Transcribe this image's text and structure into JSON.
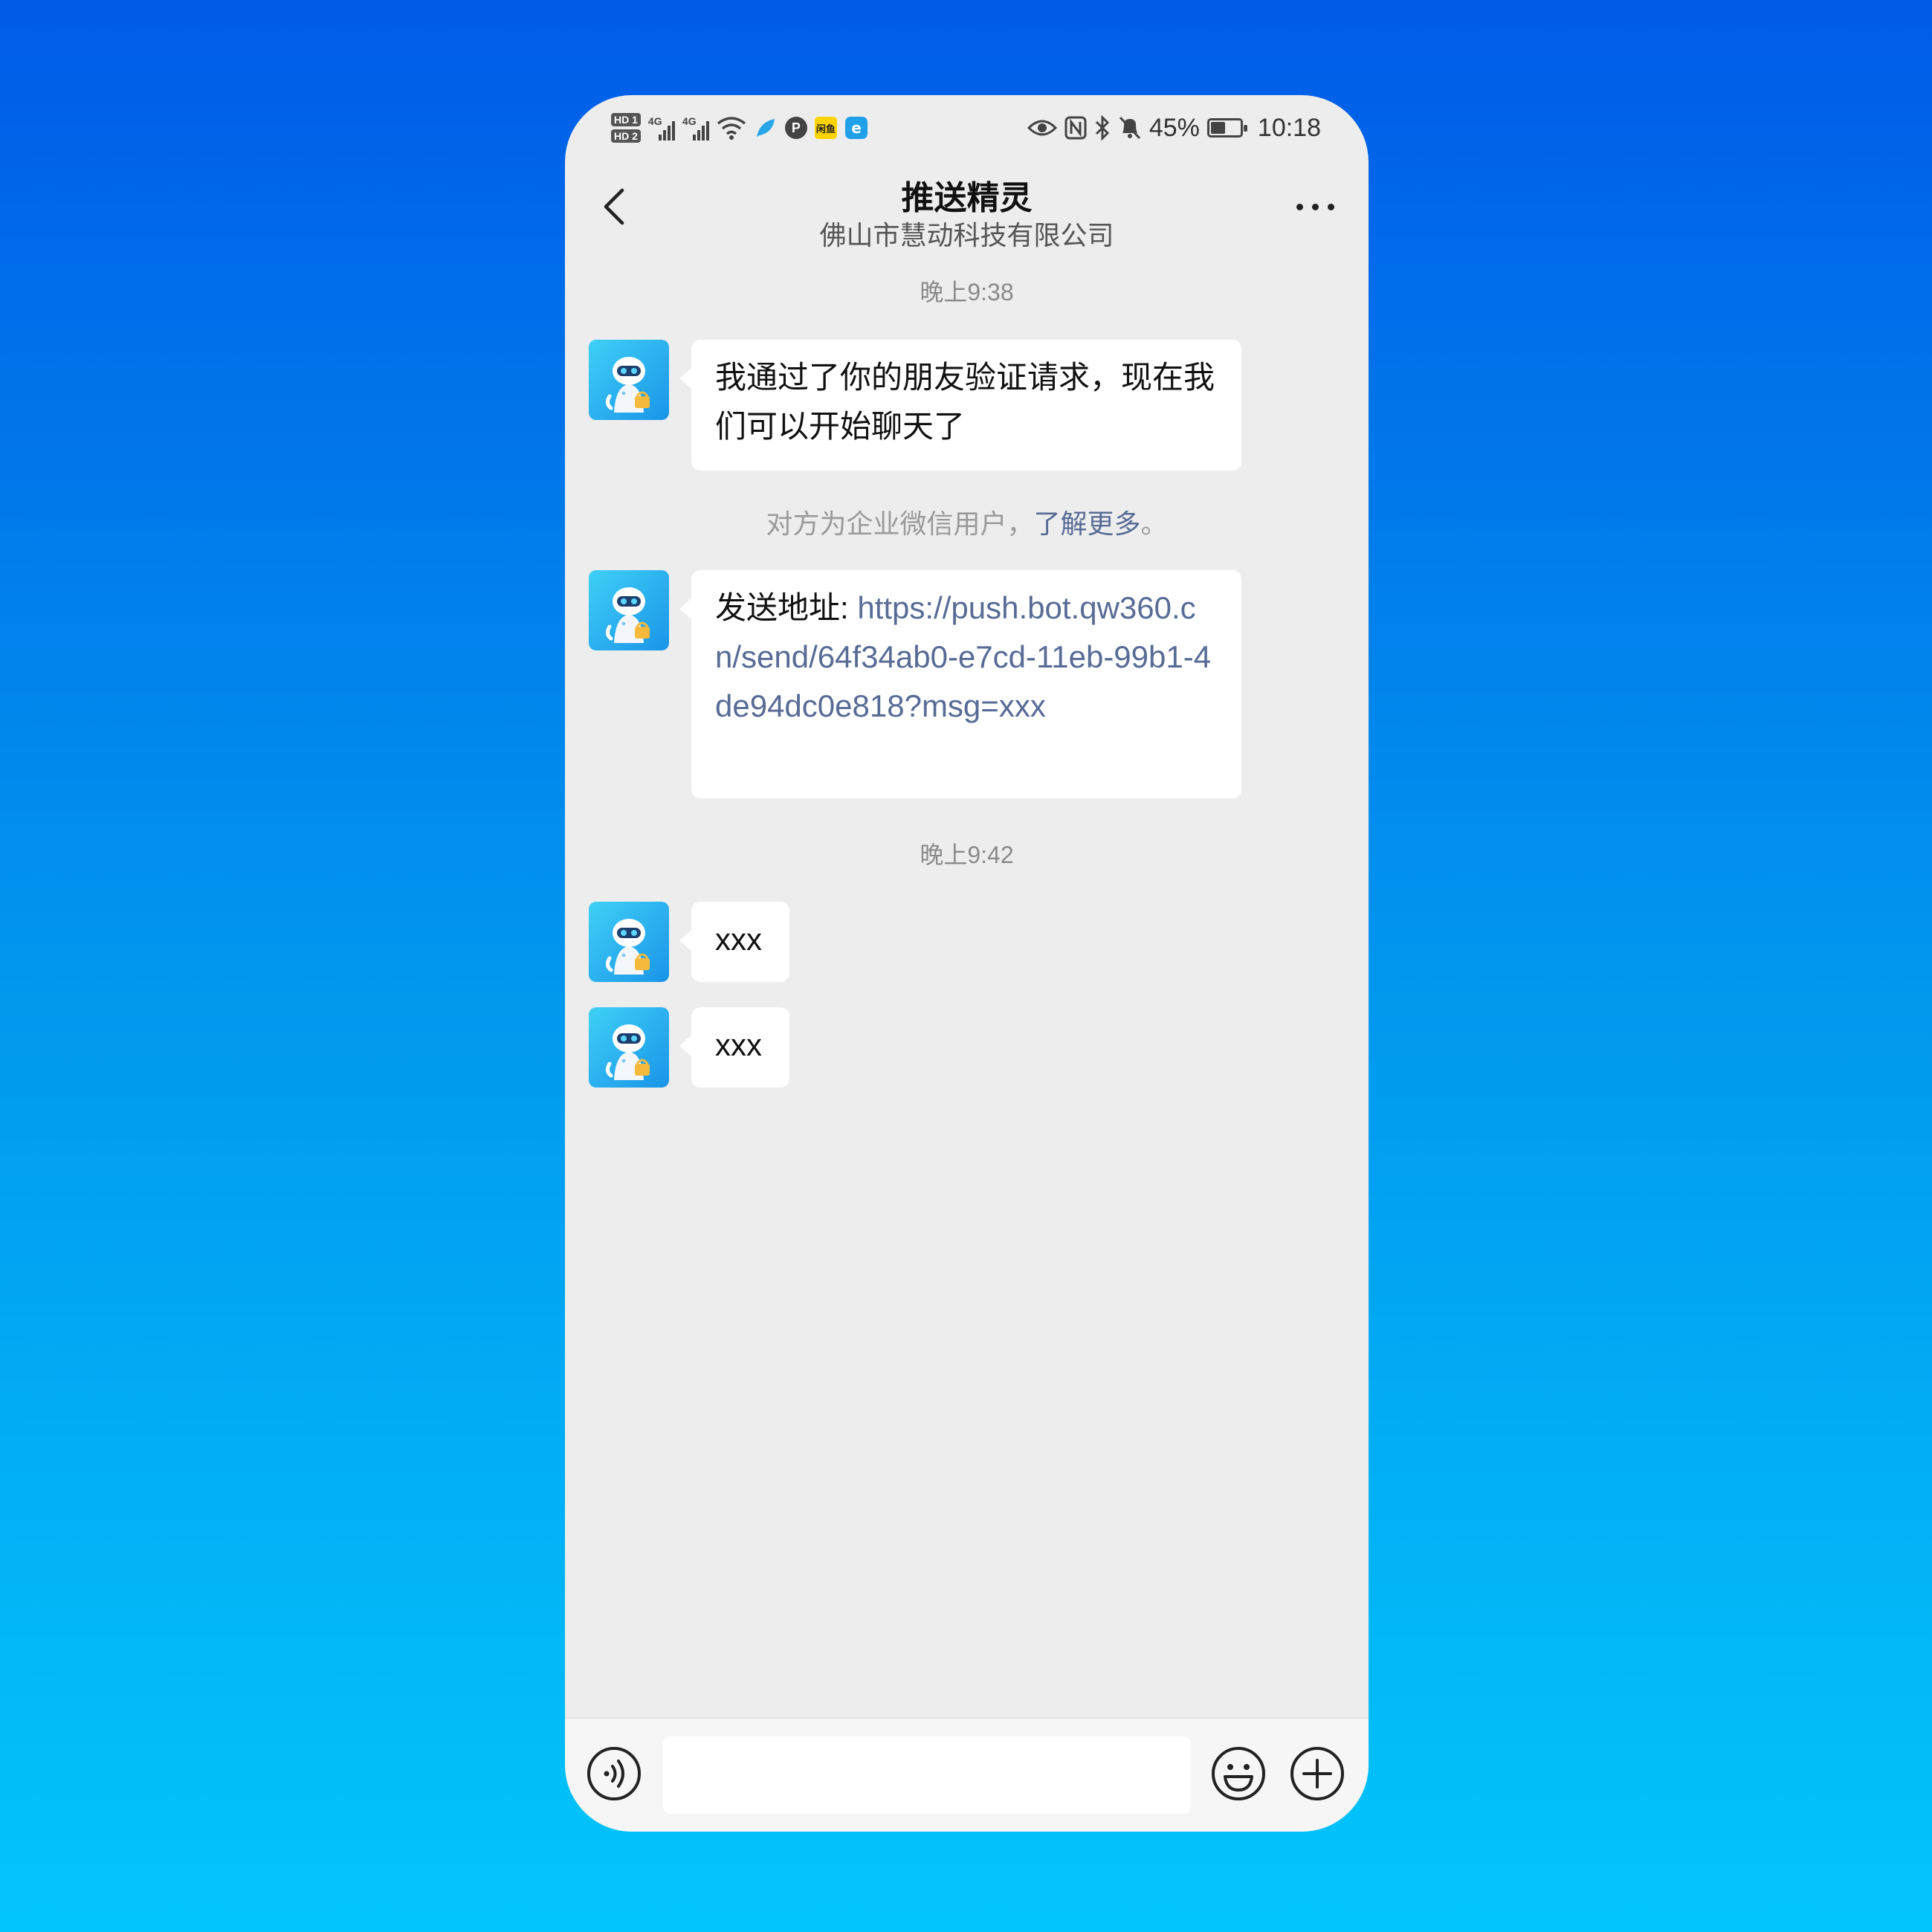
{
  "status_bar": {
    "battery_percent": "45%",
    "time": "10:18",
    "sim1_label": "HD 1",
    "sim2_label": "HD 2",
    "network1": "4G",
    "network2": "4G",
    "app_badge_p": "P",
    "app_badge_xianyu": "闲鱼",
    "icons": [
      "hd-icon",
      "signal-icon",
      "wifi-icon",
      "feather-app-icon",
      "p-app-icon",
      "xianyu-app-icon",
      "e-app-icon",
      "eye-icon",
      "nfc-icon",
      "bluetooth-icon",
      "mute-icon",
      "battery-icon"
    ]
  },
  "header": {
    "title": "推送精灵",
    "subtitle": "佛山市慧动科技有限公司",
    "back_icon": "chevron-left-icon",
    "more_icon": "more-dots-icon"
  },
  "chat": {
    "timestamp_1": "晚上9:38",
    "message_1": "我通过了你的朋友验证请求，现在我们可以开始聊天了",
    "notice_prefix": "对方为企业微信用户，",
    "notice_link": "了解更多",
    "notice_suffix": "。",
    "message_2_label": "发送地址: ",
    "message_2_url": "https://push.bot.qw360.cn/send/64f34ab0-e7cd-11eb-99b1-4de94dc0e818?msg=xxx",
    "timestamp_2": "晚上9:42",
    "message_3": "xxx",
    "message_4": "xxx"
  },
  "input_bar": {
    "value": "",
    "voice_icon": "voice-icon",
    "emoji_icon": "emoji-icon",
    "plus_icon": "plus-circle-icon"
  },
  "colors": {
    "background_top": "#005be8",
    "background_bottom": "#02c6fb",
    "chat_bg": "#ededed",
    "bubble": "#ffffff",
    "link": "#576b95"
  }
}
